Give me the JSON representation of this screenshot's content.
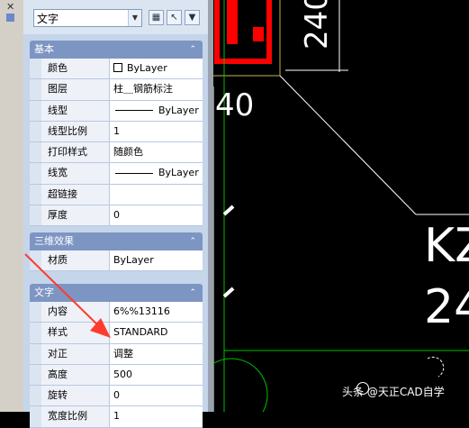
{
  "panel": {
    "selector_value": "文字",
    "icons": [
      "quick-select-icon",
      "select-objects-icon",
      "toggle-pickadd-icon"
    ]
  },
  "sections": [
    {
      "title": "基本",
      "rows": [
        {
          "label": "颜色",
          "value": "ByLayer",
          "glyph": "square"
        },
        {
          "label": "图层",
          "value": "柱＿钢筋标注",
          "glyph": ""
        },
        {
          "label": "线型",
          "value": "ByLayer",
          "glyph": "line"
        },
        {
          "label": "线型比例",
          "value": "1",
          "glyph": ""
        },
        {
          "label": "打印样式",
          "value": "随颜色",
          "glyph": ""
        },
        {
          "label": "线宽",
          "value": "ByLayer",
          "glyph": "line"
        },
        {
          "label": "超链接",
          "value": "",
          "glyph": ""
        },
        {
          "label": "厚度",
          "value": "0",
          "glyph": ""
        }
      ]
    },
    {
      "title": "三维效果",
      "rows": [
        {
          "label": "材质",
          "value": "ByLayer",
          "glyph": ""
        }
      ]
    },
    {
      "title": "文字",
      "rows": [
        {
          "label": "内容",
          "value": "6%%13116",
          "glyph": ""
        },
        {
          "label": "样式",
          "value": "STANDARD",
          "glyph": ""
        },
        {
          "label": "对正",
          "value": "调整",
          "glyph": ""
        },
        {
          "label": "高度",
          "value": "500",
          "glyph": ""
        },
        {
          "label": "旋转",
          "value": "0",
          "glyph": ""
        },
        {
          "label": "宽度比例",
          "value": "1",
          "glyph": ""
        }
      ]
    }
  ],
  "cad_text": {
    "t1": "240",
    "t2": "40",
    "t3": "KZ",
    "t4": "24"
  },
  "watermark": "头条 @天正CAD自学",
  "colors": {
    "panel_bg": "#c5d5ea",
    "section_header": "#7d95c3",
    "canvas_bg": "#000000",
    "red_geometry": "#ff0000",
    "annotation": "#ff3b2f"
  }
}
